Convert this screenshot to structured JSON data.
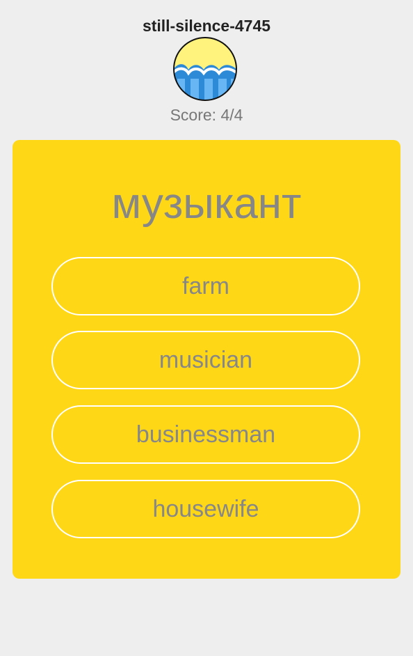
{
  "user": {
    "name": "still-silence-4745",
    "avatar_icon": "waves-avatar-icon"
  },
  "score": {
    "text": "Score: 4/4"
  },
  "quiz": {
    "word": "музыкант",
    "options": [
      "farm",
      "musician",
      "businessman",
      "housewife"
    ]
  },
  "colors": {
    "background": "#eeeeee",
    "card": "#fed717",
    "option_border": "#ffffff",
    "text": "#878787"
  }
}
